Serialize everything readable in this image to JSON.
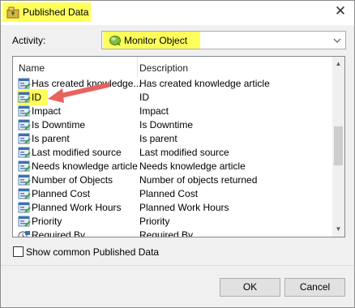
{
  "window": {
    "title": "Published Data",
    "close_glyph": "✕",
    "title_icon": "published-data-icon",
    "highlight_color": "#ffff5c"
  },
  "activity": {
    "label": "Activity:",
    "value": "Monitor Object",
    "icon": "monitor-object-icon"
  },
  "list": {
    "columns": {
      "name": "Name",
      "description": "Description"
    },
    "rows": [
      {
        "name": "Has created knowledge...",
        "description": "Has created knowledge article"
      },
      {
        "name": "ID",
        "description": "ID"
      },
      {
        "name": "Impact",
        "description": "Impact"
      },
      {
        "name": "Is Downtime",
        "description": "Is Downtime"
      },
      {
        "name": "Is parent",
        "description": "Is parent"
      },
      {
        "name": "Last modified source",
        "description": "Last modified source"
      },
      {
        "name": "Needs knowledge article",
        "description": "Needs knowledge article"
      },
      {
        "name": "Number of Objects",
        "description": "Number of objects returned"
      },
      {
        "name": "Planned Cost",
        "description": "Planned Cost"
      },
      {
        "name": "Planned Work Hours",
        "description": "Planned Work Hours"
      },
      {
        "name": "Priority",
        "description": "Priority"
      },
      {
        "name": "Required By",
        "description": "Required By"
      }
    ],
    "annotation_arrow_color": "#e8625e"
  },
  "checkbox": {
    "label": "Show common Published Data",
    "checked": false
  },
  "buttons": {
    "ok": "OK",
    "cancel": "Cancel"
  }
}
